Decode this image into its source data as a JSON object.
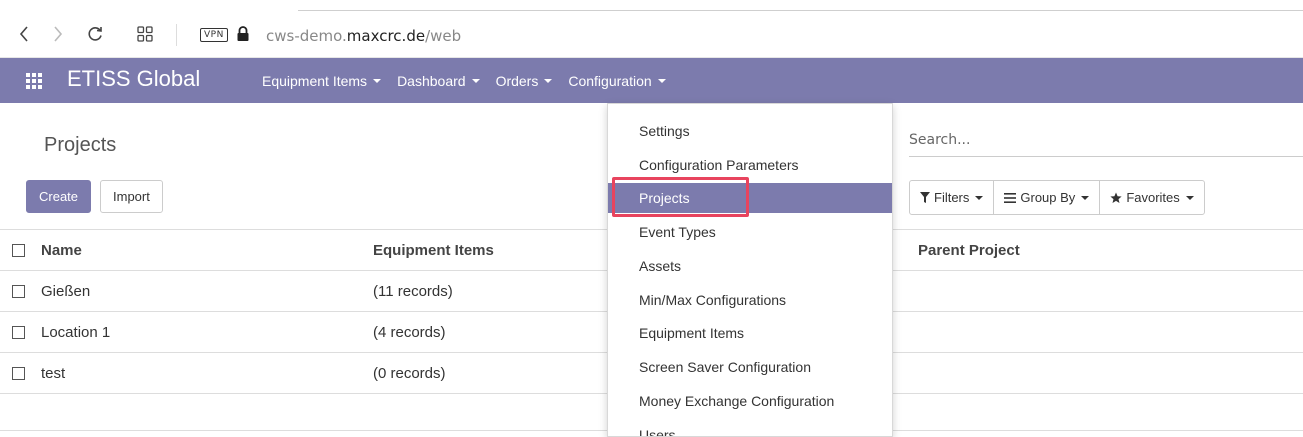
{
  "browser": {
    "vpn_label": "VPN",
    "url_prefix": "cws-demo.",
    "url_domain": "maxcrc.de",
    "url_path": "/web"
  },
  "app": {
    "brand": "ETISS Global",
    "menu": [
      "Equipment Items",
      "Dashboard",
      "Orders",
      "Configuration"
    ]
  },
  "page": {
    "title": "Projects",
    "create_label": "Create",
    "import_label": "Import",
    "search_placeholder": "Search...",
    "filters_label": "Filters",
    "groupby_label": "Group By",
    "favorites_label": "Favorites"
  },
  "table": {
    "columns": [
      "Name",
      "Equipment Items",
      "Parent Project"
    ],
    "rows": [
      {
        "name": "Gießen",
        "equipment": "(11 records)"
      },
      {
        "name": "Location 1",
        "equipment": "(4 records)"
      },
      {
        "name": "test",
        "equipment": "(0 records)"
      }
    ]
  },
  "dropdown": {
    "items": [
      "Settings",
      "Configuration Parameters",
      "Projects",
      "Event Types",
      "Assets",
      "Min/Max Configurations",
      "Equipment Items",
      "Screen Saver Configuration",
      "Money Exchange Configuration",
      "Users"
    ],
    "active_index": 2
  },
  "colors": {
    "brand": "#7c7bad",
    "highlight": "#e8445e"
  }
}
